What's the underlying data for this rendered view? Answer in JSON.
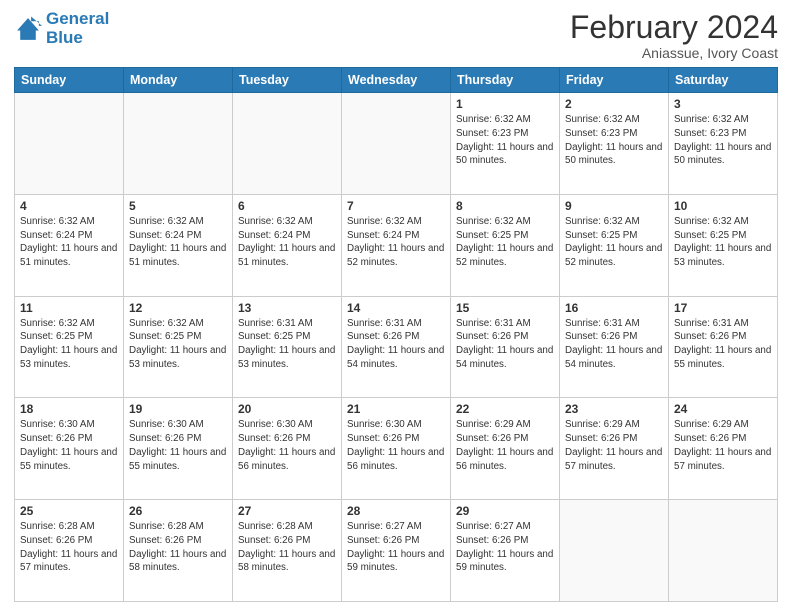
{
  "logo": {
    "line1": "General",
    "line2": "Blue"
  },
  "title": "February 2024",
  "subtitle": "Aniassue, Ivory Coast",
  "days_header": [
    "Sunday",
    "Monday",
    "Tuesday",
    "Wednesday",
    "Thursday",
    "Friday",
    "Saturday"
  ],
  "weeks": [
    [
      {
        "day": "",
        "info": ""
      },
      {
        "day": "",
        "info": ""
      },
      {
        "day": "",
        "info": ""
      },
      {
        "day": "",
        "info": ""
      },
      {
        "day": "1",
        "info": "Sunrise: 6:32 AM\nSunset: 6:23 PM\nDaylight: 11 hours and 50 minutes."
      },
      {
        "day": "2",
        "info": "Sunrise: 6:32 AM\nSunset: 6:23 PM\nDaylight: 11 hours and 50 minutes."
      },
      {
        "day": "3",
        "info": "Sunrise: 6:32 AM\nSunset: 6:23 PM\nDaylight: 11 hours and 50 minutes."
      }
    ],
    [
      {
        "day": "4",
        "info": "Sunrise: 6:32 AM\nSunset: 6:24 PM\nDaylight: 11 hours and 51 minutes."
      },
      {
        "day": "5",
        "info": "Sunrise: 6:32 AM\nSunset: 6:24 PM\nDaylight: 11 hours and 51 minutes."
      },
      {
        "day": "6",
        "info": "Sunrise: 6:32 AM\nSunset: 6:24 PM\nDaylight: 11 hours and 51 minutes."
      },
      {
        "day": "7",
        "info": "Sunrise: 6:32 AM\nSunset: 6:24 PM\nDaylight: 11 hours and 52 minutes."
      },
      {
        "day": "8",
        "info": "Sunrise: 6:32 AM\nSunset: 6:25 PM\nDaylight: 11 hours and 52 minutes."
      },
      {
        "day": "9",
        "info": "Sunrise: 6:32 AM\nSunset: 6:25 PM\nDaylight: 11 hours and 52 minutes."
      },
      {
        "day": "10",
        "info": "Sunrise: 6:32 AM\nSunset: 6:25 PM\nDaylight: 11 hours and 53 minutes."
      }
    ],
    [
      {
        "day": "11",
        "info": "Sunrise: 6:32 AM\nSunset: 6:25 PM\nDaylight: 11 hours and 53 minutes."
      },
      {
        "day": "12",
        "info": "Sunrise: 6:32 AM\nSunset: 6:25 PM\nDaylight: 11 hours and 53 minutes."
      },
      {
        "day": "13",
        "info": "Sunrise: 6:31 AM\nSunset: 6:25 PM\nDaylight: 11 hours and 53 minutes."
      },
      {
        "day": "14",
        "info": "Sunrise: 6:31 AM\nSunset: 6:26 PM\nDaylight: 11 hours and 54 minutes."
      },
      {
        "day": "15",
        "info": "Sunrise: 6:31 AM\nSunset: 6:26 PM\nDaylight: 11 hours and 54 minutes."
      },
      {
        "day": "16",
        "info": "Sunrise: 6:31 AM\nSunset: 6:26 PM\nDaylight: 11 hours and 54 minutes."
      },
      {
        "day": "17",
        "info": "Sunrise: 6:31 AM\nSunset: 6:26 PM\nDaylight: 11 hours and 55 minutes."
      }
    ],
    [
      {
        "day": "18",
        "info": "Sunrise: 6:30 AM\nSunset: 6:26 PM\nDaylight: 11 hours and 55 minutes."
      },
      {
        "day": "19",
        "info": "Sunrise: 6:30 AM\nSunset: 6:26 PM\nDaylight: 11 hours and 55 minutes."
      },
      {
        "day": "20",
        "info": "Sunrise: 6:30 AM\nSunset: 6:26 PM\nDaylight: 11 hours and 56 minutes."
      },
      {
        "day": "21",
        "info": "Sunrise: 6:30 AM\nSunset: 6:26 PM\nDaylight: 11 hours and 56 minutes."
      },
      {
        "day": "22",
        "info": "Sunrise: 6:29 AM\nSunset: 6:26 PM\nDaylight: 11 hours and 56 minutes."
      },
      {
        "day": "23",
        "info": "Sunrise: 6:29 AM\nSunset: 6:26 PM\nDaylight: 11 hours and 57 minutes."
      },
      {
        "day": "24",
        "info": "Sunrise: 6:29 AM\nSunset: 6:26 PM\nDaylight: 11 hours and 57 minutes."
      }
    ],
    [
      {
        "day": "25",
        "info": "Sunrise: 6:28 AM\nSunset: 6:26 PM\nDaylight: 11 hours and 57 minutes."
      },
      {
        "day": "26",
        "info": "Sunrise: 6:28 AM\nSunset: 6:26 PM\nDaylight: 11 hours and 58 minutes."
      },
      {
        "day": "27",
        "info": "Sunrise: 6:28 AM\nSunset: 6:26 PM\nDaylight: 11 hours and 58 minutes."
      },
      {
        "day": "28",
        "info": "Sunrise: 6:27 AM\nSunset: 6:26 PM\nDaylight: 11 hours and 59 minutes."
      },
      {
        "day": "29",
        "info": "Sunrise: 6:27 AM\nSunset: 6:26 PM\nDaylight: 11 hours and 59 minutes."
      },
      {
        "day": "",
        "info": ""
      },
      {
        "day": "",
        "info": ""
      }
    ]
  ]
}
